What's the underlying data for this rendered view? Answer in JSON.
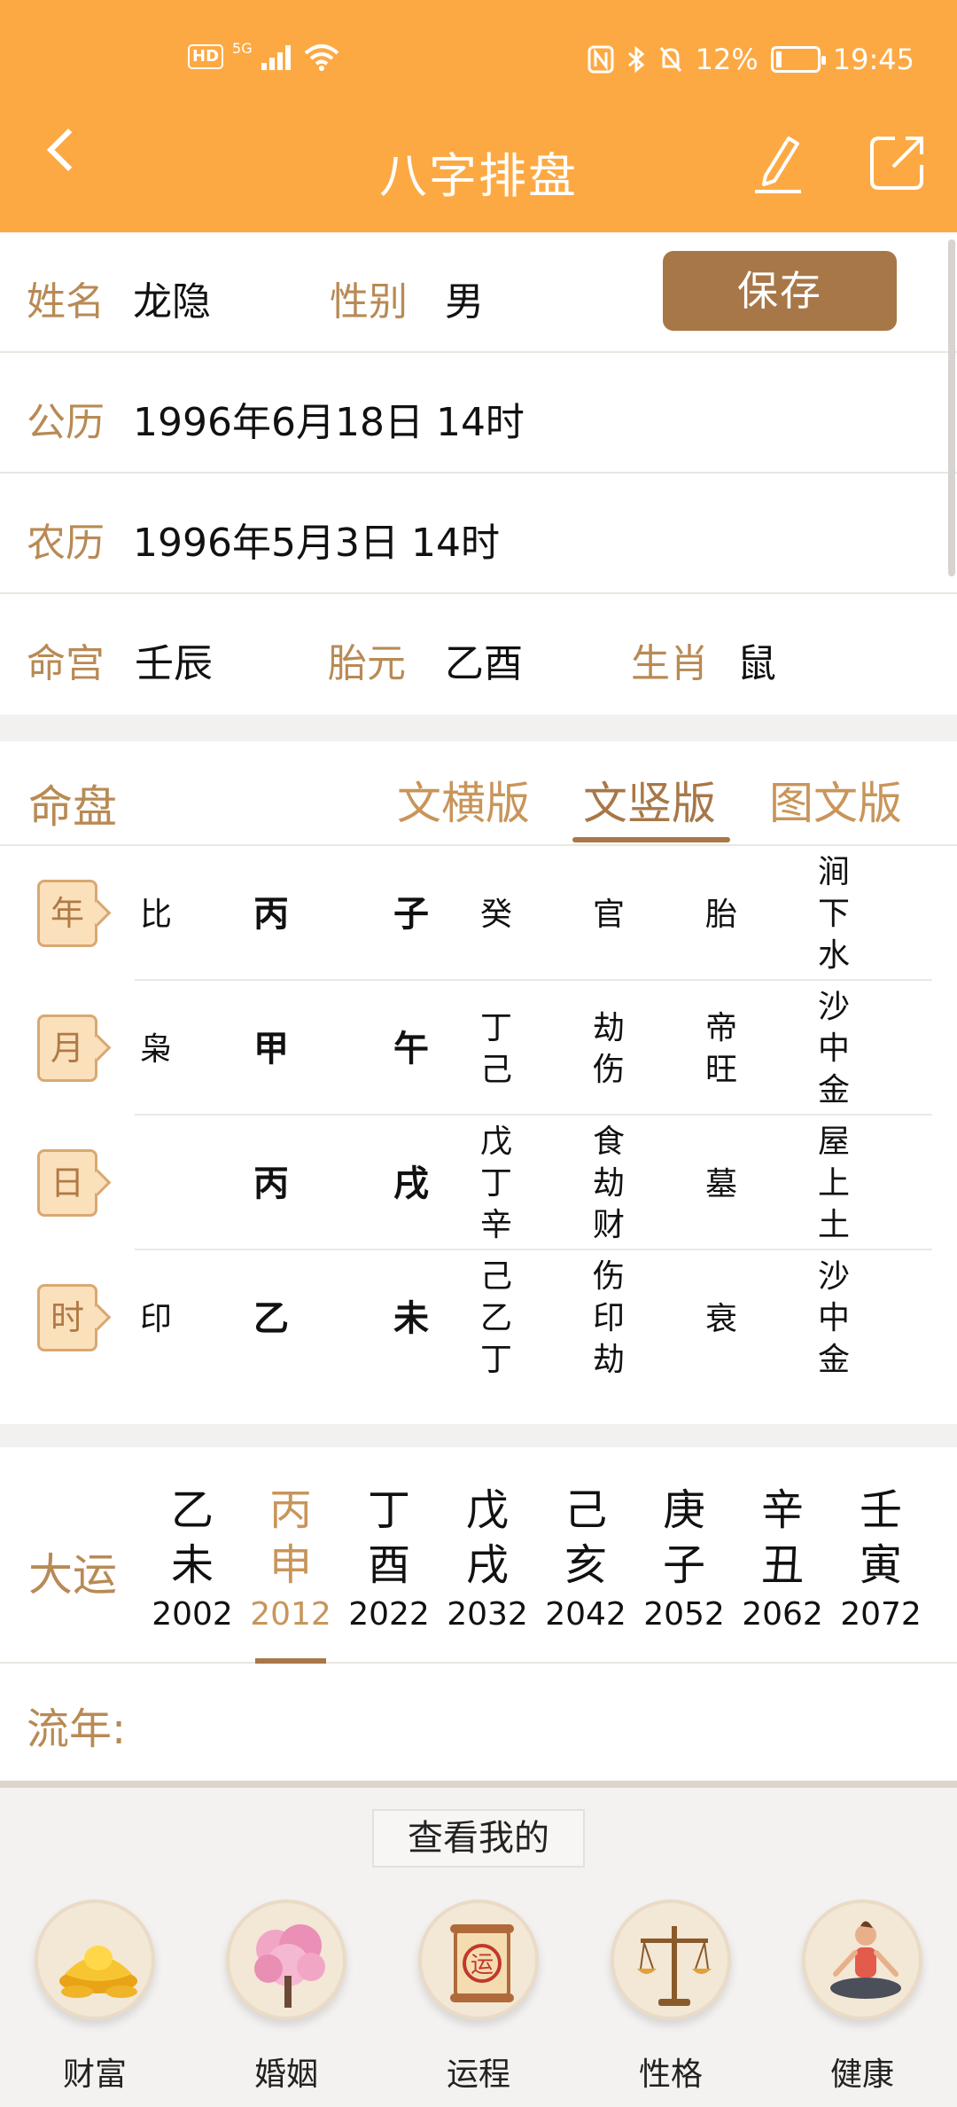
{
  "status_bar": {
    "signal_type": "5G",
    "hd": "HD",
    "battery": "12%",
    "time": "19:45"
  },
  "header": {
    "title": "八字排盘"
  },
  "profile": {
    "name_label": "姓名",
    "name": "龙隐",
    "gender_label": "性别",
    "gender": "男",
    "save_label": "保存",
    "solar_label": "公历",
    "solar": "1996年6月18日 14时",
    "lunar_label": "农历",
    "lunar": "1996年5月3日 14时",
    "minggong_label": "命宫",
    "minggong": "壬辰",
    "taiyuan_label": "胎元",
    "taiyuan": "乙酉",
    "zodiac_label": "生肖",
    "zodiac": "鼠"
  },
  "chart": {
    "heading": "命盘",
    "tabs": [
      "文横版",
      "文竖版",
      "图文版"
    ],
    "active_tab": 1,
    "rows": [
      {
        "pillar": "年",
        "god": "比",
        "stem": "丙",
        "branch": "子",
        "hidden": "癸",
        "hidden_god": "官",
        "stage": "胎",
        "nayin": "涧下水"
      },
      {
        "pillar": "月",
        "god": "枭",
        "stem": "甲",
        "branch": "午",
        "hidden": "丁己",
        "hidden_god": "劫伤",
        "stage": "帝旺",
        "nayin": "沙中金"
      },
      {
        "pillar": "日",
        "god": "",
        "stem": "丙",
        "branch": "戌",
        "hidden": "戊丁辛",
        "hidden_god": "食劫财",
        "stage": "墓",
        "nayin": "屋上土"
      },
      {
        "pillar": "时",
        "god": "印",
        "stem": "乙",
        "branch": "未",
        "hidden": "己乙丁",
        "hidden_god": "伤印劫",
        "stage": "衰",
        "nayin": "沙中金"
      }
    ]
  },
  "dayun": {
    "heading": "大运",
    "active": 1,
    "items": [
      {
        "stem": "乙",
        "branch": "未",
        "year": "2002"
      },
      {
        "stem": "丙",
        "branch": "申",
        "year": "2012"
      },
      {
        "stem": "丁",
        "branch": "酉",
        "year": "2022"
      },
      {
        "stem": "戊",
        "branch": "戌",
        "year": "2032"
      },
      {
        "stem": "己",
        "branch": "亥",
        "year": "2042"
      },
      {
        "stem": "庚",
        "branch": "子",
        "year": "2052"
      },
      {
        "stem": "辛",
        "branch": "丑",
        "year": "2062"
      },
      {
        "stem": "壬",
        "branch": "寅",
        "year": "2072"
      }
    ]
  },
  "liunian": {
    "label": "流年:"
  },
  "bottom": {
    "title": "查看我的",
    "features": [
      {
        "label": "财富",
        "icon": "gold-ingot-icon"
      },
      {
        "label": "婚姻",
        "icon": "blossom-tree-icon"
      },
      {
        "label": "运程",
        "icon": "fortune-scroll-icon"
      },
      {
        "label": "性格",
        "icon": "balance-scale-icon"
      },
      {
        "label": "健康",
        "icon": "meditation-icon"
      }
    ]
  },
  "colors": {
    "header_bg": "#fda943",
    "accent": "#a87748",
    "label": "#b88a55"
  }
}
